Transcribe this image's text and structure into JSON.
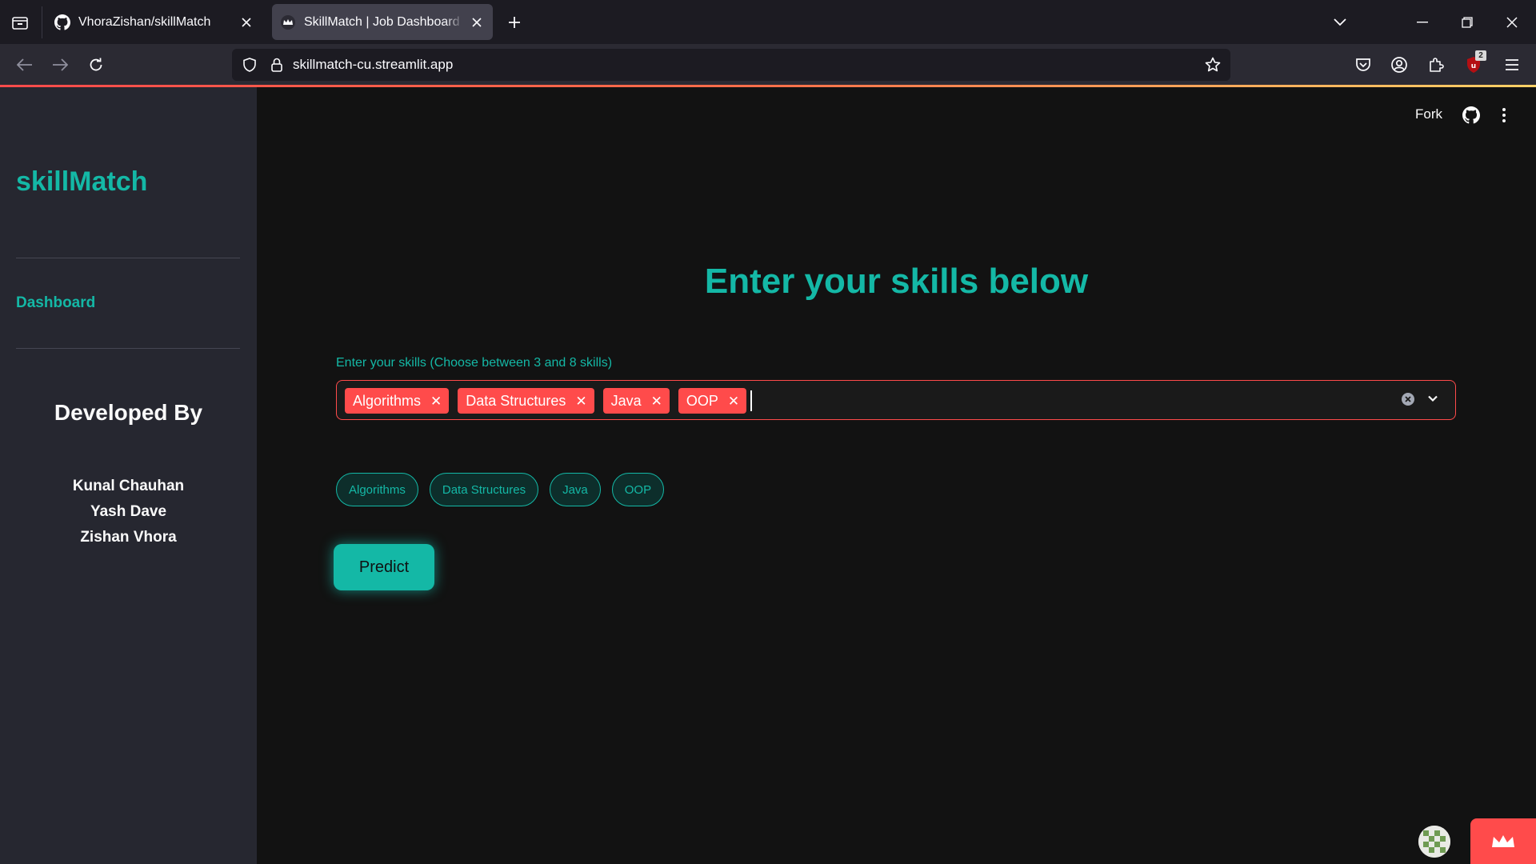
{
  "browser": {
    "tabs": [
      {
        "title": "VhoraZishan/skillMatch",
        "favicon": "github-icon",
        "active": false
      },
      {
        "title": "SkillMatch | Job Dashboard · Streamlit",
        "favicon": "streamlit-crown-icon",
        "active": true
      }
    ],
    "url": "skillmatch-cu.streamlit.app",
    "ublock_badge": "2"
  },
  "sidebar": {
    "brand": "skillMatch",
    "nav": [
      {
        "label": "Dashboard"
      }
    ],
    "developed_by_heading": "Developed By",
    "developers": [
      "Kunal Chauhan",
      "Yash Dave",
      "Zishan Vhora"
    ]
  },
  "header": {
    "fork_label": "Fork"
  },
  "main": {
    "heading": "Enter your skills below",
    "skills_label": "Enter your skills (Choose between 3 and 8 skills)",
    "selected_skills": [
      "Algorithms",
      "Data Structures",
      "Java",
      "OOP"
    ],
    "skill_pills": [
      "Algorithms",
      "Data Structures",
      "Java",
      "OOP"
    ],
    "predict_label": "Predict"
  },
  "colors": {
    "accent": "#14b8a6",
    "chip": "#ff4b4b",
    "sidebar_bg": "#262730",
    "main_bg": "#121212"
  }
}
